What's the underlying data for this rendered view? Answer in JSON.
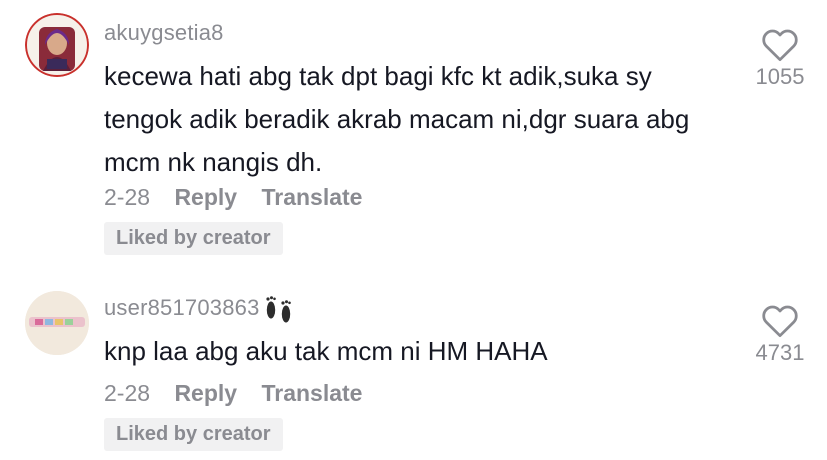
{
  "comments": [
    {
      "username": "akuygsetia8",
      "text": "kecewa hati abg tak dpt bagi kfc kt adik,suka sy tengok adik beradik akrab macam ni,dgr suara abg mcm nk nangis dh.",
      "date": "2-28",
      "reply_label": "Reply",
      "translate_label": "Translate",
      "badge": "Liked by creator",
      "likes": "1055",
      "icon": "heart-outline-icon"
    },
    {
      "username": "user851703863",
      "username_emoji": "footprints-icon",
      "text": "knp laa abg aku tak mcm ni HM HAHA",
      "date": "2-28",
      "reply_label": "Reply",
      "translate_label": "Translate",
      "badge": "Liked by creator",
      "likes": "4731",
      "icon": "heart-outline-icon"
    }
  ],
  "colors": {
    "primary_text": "#161823",
    "secondary_text": "#8a8b91",
    "badge_bg": "#f1f1f2"
  }
}
